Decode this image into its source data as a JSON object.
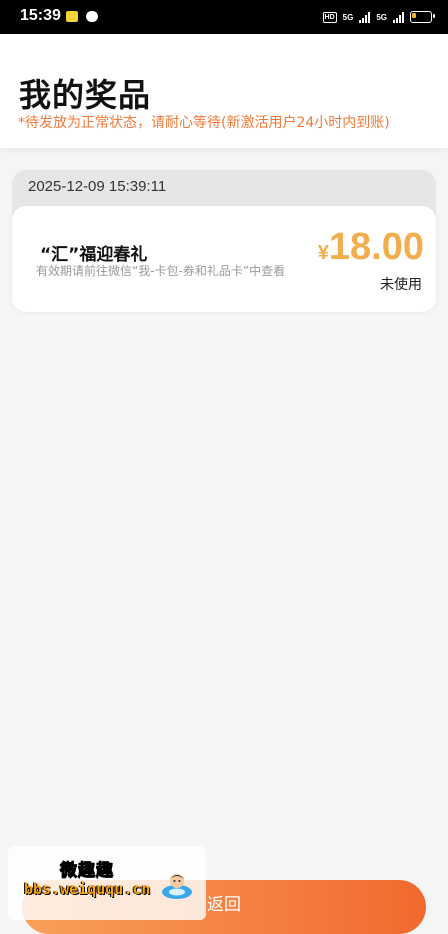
{
  "status_bar": {
    "time": "15:39",
    "hd_label": "HD",
    "network_1": "5G",
    "network_2": "5G",
    "icons": [
      "notification-icon",
      "chat-icon",
      "hd-icon",
      "signal-icon",
      "signal-icon",
      "battery-icon"
    ]
  },
  "header": {
    "title": "我的奖品",
    "notice": "*待发放为正常状态，请耐心等待(新激活用户24小时内到账)"
  },
  "prizes": [
    {
      "date": "2025-12-09 15:39:11",
      "name": "“汇”福迎春礼",
      "description": "有效期请前往微信“我-卡包-券和礼品卡”中查看",
      "currency": "¥",
      "amount": "18.00",
      "status": "未使用"
    }
  ],
  "footer": {
    "return_label": "返回"
  },
  "watermark": {
    "title": "微趣趣",
    "url": "bbs.weiququ.cn"
  },
  "colors": {
    "accent_orange": "#f07a3a",
    "amount_color": "#f2ae4d",
    "button_gradient_start": "#f8a05a",
    "button_gradient_end": "#f2692e"
  }
}
